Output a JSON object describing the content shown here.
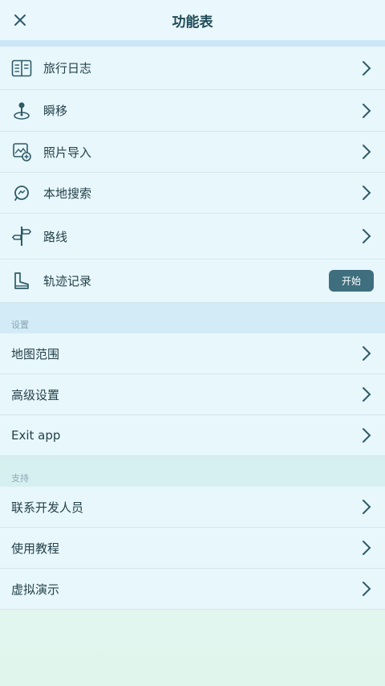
{
  "header": {
    "title": "功能表"
  },
  "main_items": [
    {
      "label": "旅行日志",
      "icon": "journal-icon"
    },
    {
      "label": "瞬移",
      "icon": "teleport-icon"
    },
    {
      "label": "照片导入",
      "icon": "photo-import-icon"
    },
    {
      "label": "本地搜索",
      "icon": "local-search-icon"
    },
    {
      "label": "路线",
      "icon": "route-signpost-icon"
    },
    {
      "label": "轨迹记录",
      "icon": "track-record-icon",
      "button": "开始"
    }
  ],
  "settings": {
    "heading": "设置",
    "items": [
      {
        "label": "地图范围"
      },
      {
        "label": "高级设置"
      },
      {
        "label": "Exit app"
      }
    ]
  },
  "support": {
    "heading": "支持",
    "items": [
      {
        "label": "联系开发人员"
      },
      {
        "label": "使用教程"
      },
      {
        "label": "虚拟演示"
      }
    ]
  },
  "colors": {
    "accent": "#3f6f7e",
    "icon": "#2f5a66",
    "text": "#24414a"
  }
}
